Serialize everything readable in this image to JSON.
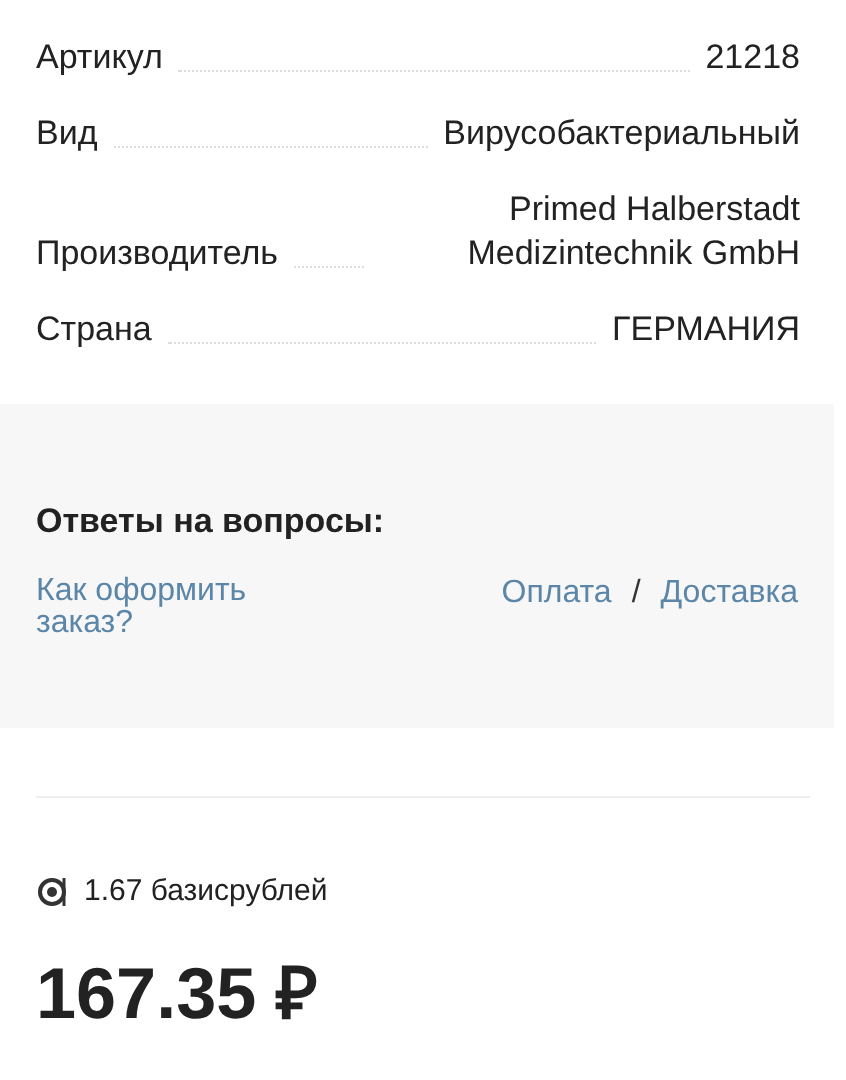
{
  "specs": [
    {
      "label": "Артикул",
      "value": "21218"
    },
    {
      "label": "Вид",
      "value": "Вирусобактериальный"
    },
    {
      "label": "Производитель",
      "value": "Primed Halberstadt Medizintechnik GmbH"
    },
    {
      "label": "Страна",
      "value": "ГЕРМАНИЯ"
    }
  ],
  "faq": {
    "title": "Ответы на вопросы:",
    "order_link": "Как оформить заказ?",
    "links": [
      "Оплата",
      "Доставка"
    ],
    "separator": "/"
  },
  "bonus": "1.67 базисрублей",
  "price": "167.35 ₽"
}
